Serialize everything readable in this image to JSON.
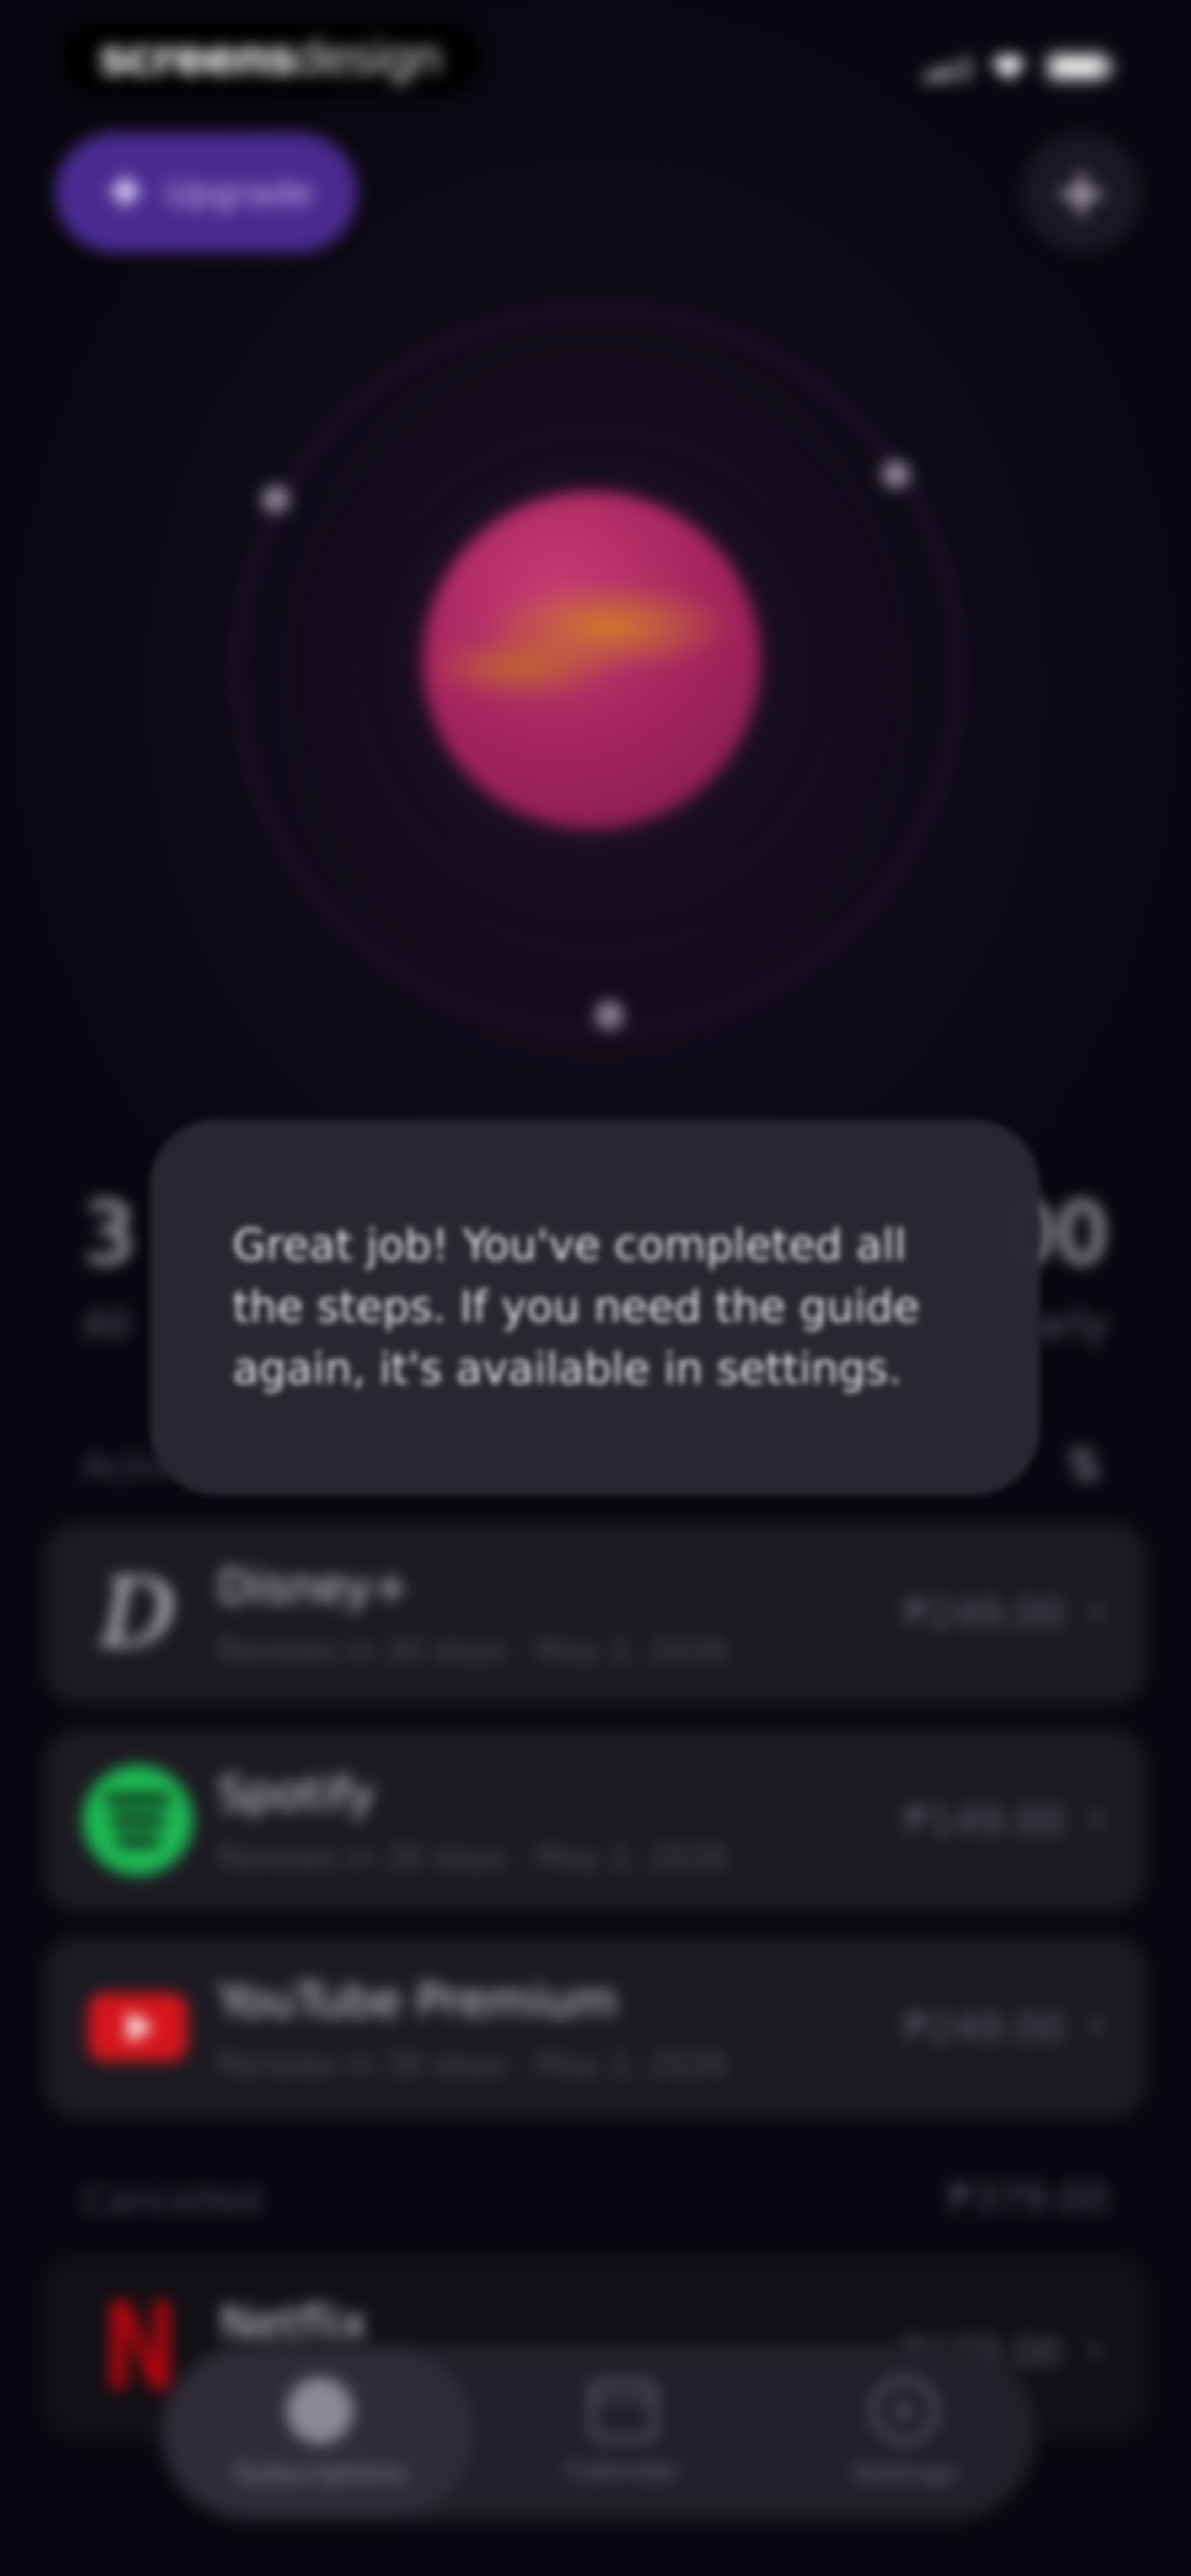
{
  "status_bar": {
    "brand_part1": "screens",
    "brand_part2": "design"
  },
  "top": {
    "upgrade_label": "Upgrade",
    "add_label": "+"
  },
  "summary": {
    "left_value": "3",
    "left_caption": "All",
    "right_value": "00",
    "right_caption": "arly"
  },
  "toast": {
    "message": "Great job! You've completed all the steps. If you need the guide again, it's available in settings."
  },
  "sections": {
    "active_label": "Activ",
    "sort_icon": "⇅",
    "cancelled_label": "Cancelled",
    "cancelled_total": "₱379.00"
  },
  "subscriptions": [
    {
      "name": "Disney+",
      "meta": "Renews in 30 days · May 2, 2026",
      "price": "₱249.00",
      "logo": "disney-logo"
    },
    {
      "name": "Spotify",
      "meta": "Renews in 30 days · May 2, 2026",
      "price": "₱149.00",
      "logo": "spotify-logo"
    },
    {
      "name": "YouTube Premium",
      "meta": "Renews in 30 days · May 2, 2026",
      "price": "₱249.00",
      "logo": "youtube-logo"
    }
  ],
  "cancelled": [
    {
      "name": "Netflix",
      "price": "₱179.00",
      "logo": "netflix-logo"
    }
  ],
  "tabbar": {
    "subscriptions": "Subscriptions",
    "calendar": "Calendar",
    "settings": "Settings"
  },
  "colors": {
    "accent": "#4a2a8f",
    "spotify": "#1db954",
    "youtube": "#d5151d",
    "netflix": "#b0060f"
  }
}
